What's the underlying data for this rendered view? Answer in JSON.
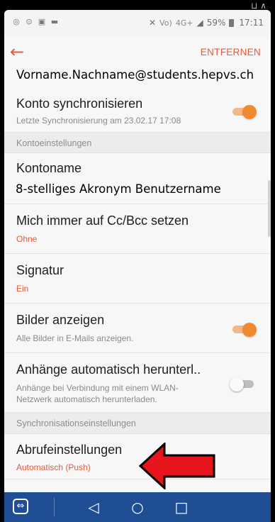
{
  "status_bar": {
    "network": "4G+",
    "battery": "59%",
    "time": "17:11"
  },
  "header": {
    "remove_label": "ENTFERNEN",
    "account_email": "Vorname.Nachname@students.hepvs.ch"
  },
  "settings": {
    "sync": {
      "title": "Konto synchronisieren",
      "subtitle": "Letzte Synchronisierung am 23.02.17  17:08",
      "enabled": true
    },
    "section_account": "Kontoeinstellungen",
    "account_name": {
      "title": "Kontoname",
      "value": "8-stelliges Akronym Benutzername"
    },
    "cc_bcc": {
      "title": "Mich immer auf Cc/Bcc setzen",
      "value": "Ohne"
    },
    "signature": {
      "title": "Signatur",
      "value": "Ein"
    },
    "show_images": {
      "title": "Bilder anzeigen",
      "subtitle": "Alle Bilder in E-Mails anzeigen.",
      "enabled": true
    },
    "attachments": {
      "title": "Anhänge automatisch herunterl..",
      "subtitle_line1": "Anhänge bei Verbindung mit einem WLAN-",
      "subtitle_line2": "Netzwerk automatisch herunterladen.",
      "enabled": false
    },
    "section_sync": "Synchronisationseinstellungen",
    "fetch": {
      "title": "Abrufeinstellungen",
      "value": "Automatisch (Push)"
    }
  },
  "colors": {
    "accent": "#e25a3c",
    "toggle_on": "#f08a30",
    "nav_bar": "#1f4e94",
    "annotation_arrow": "#e8141b"
  }
}
